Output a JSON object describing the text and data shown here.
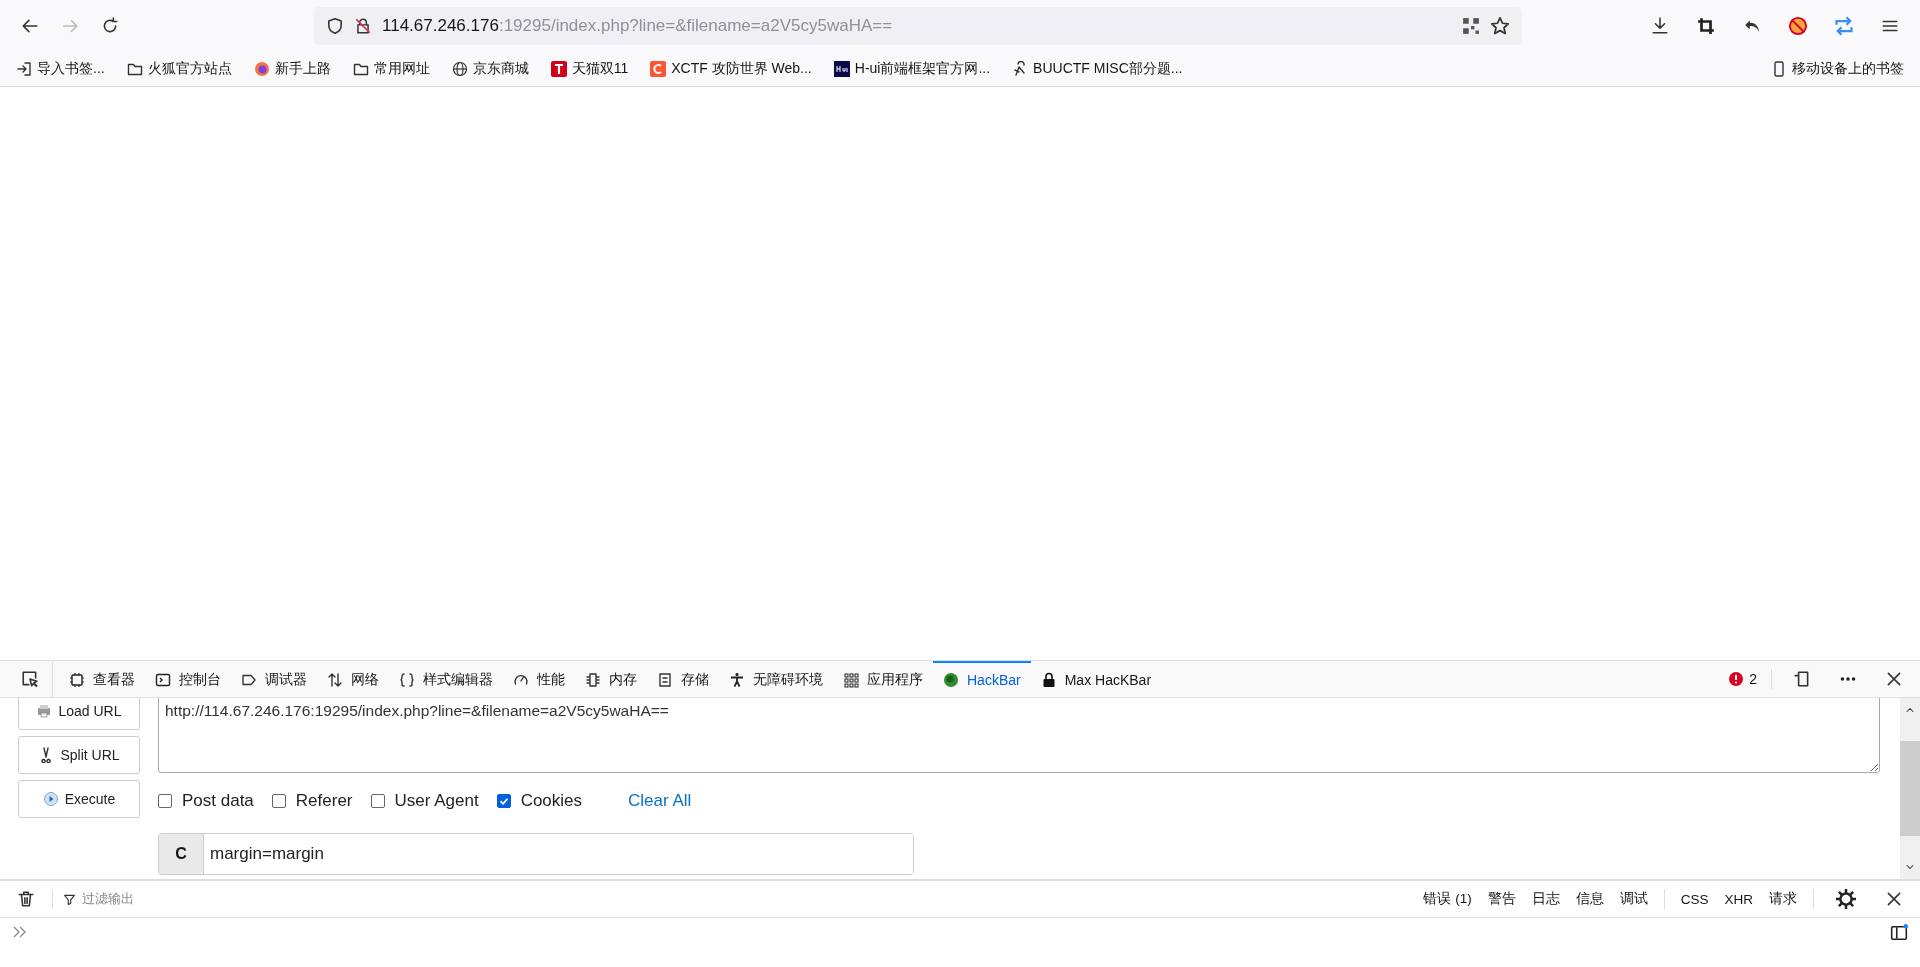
{
  "browser": {
    "url_host": "114.67.246.176",
    "url_rest": ":19295/index.php?line=&filename=a2V5cy5waHA==",
    "bookmarks": [
      {
        "label": "导入书签...",
        "kind": "import"
      },
      {
        "label": "火狐官方站点",
        "kind": "folder"
      },
      {
        "label": "新手上路",
        "kind": "firefox"
      },
      {
        "label": "常用网址",
        "kind": "folder"
      },
      {
        "label": "京东商城",
        "kind": "globe"
      },
      {
        "label": "天猫双11",
        "kind": "tmall"
      },
      {
        "label": "XCTF 攻防世界 Web...",
        "kind": "csdn"
      },
      {
        "label": "H-ui前端框架官方网...",
        "kind": "hui"
      },
      {
        "label": "BUUCTF MISC部分题...",
        "kind": "buu"
      }
    ],
    "mobile_bookmarks": "移动设备上的书签"
  },
  "devtools": {
    "tabs": [
      {
        "label": "查看器",
        "kind": "inspector",
        "selected": false
      },
      {
        "label": "控制台",
        "kind": "console",
        "selected": false
      },
      {
        "label": "调试器",
        "kind": "debugger",
        "selected": false
      },
      {
        "label": "网络",
        "kind": "network",
        "selected": false
      },
      {
        "label": "样式编辑器",
        "kind": "style",
        "selected": false
      },
      {
        "label": "性能",
        "kind": "performance",
        "selected": false
      },
      {
        "label": "内存",
        "kind": "memory",
        "selected": false
      },
      {
        "label": "存储",
        "kind": "storage",
        "selected": false
      },
      {
        "label": "无障碍环境",
        "kind": "a11y",
        "selected": false
      },
      {
        "label": "应用程序",
        "kind": "app",
        "selected": false
      },
      {
        "label": "HackBar",
        "kind": "hackbar",
        "selected": true
      },
      {
        "label": "Max HacKBar",
        "kind": "max",
        "selected": false
      }
    ],
    "error_count": "2"
  },
  "hackbar": {
    "buttons": [
      {
        "label": "Load URL",
        "kind": "load"
      },
      {
        "label": "Split URL",
        "kind": "split"
      },
      {
        "label": "Execute",
        "kind": "execute"
      }
    ],
    "url": "http://114.67.246.176:19295/index.php?line=&filename=a2V5cy5waHA==",
    "options": [
      {
        "label": "Post data",
        "checked": false
      },
      {
        "label": "Referer",
        "checked": false
      },
      {
        "label": "User Agent",
        "checked": false
      },
      {
        "label": "Cookies",
        "checked": true
      }
    ],
    "clear_all": "Clear All",
    "cookie_field": {
      "prefix": "C",
      "value": "margin=margin"
    }
  },
  "console": {
    "filter_placeholder": "过滤输出",
    "levels": [
      "错误 (1)",
      "警告",
      "日志",
      "信息",
      "调试"
    ],
    "requests": [
      "CSS",
      "XHR",
      "请求"
    ]
  }
}
